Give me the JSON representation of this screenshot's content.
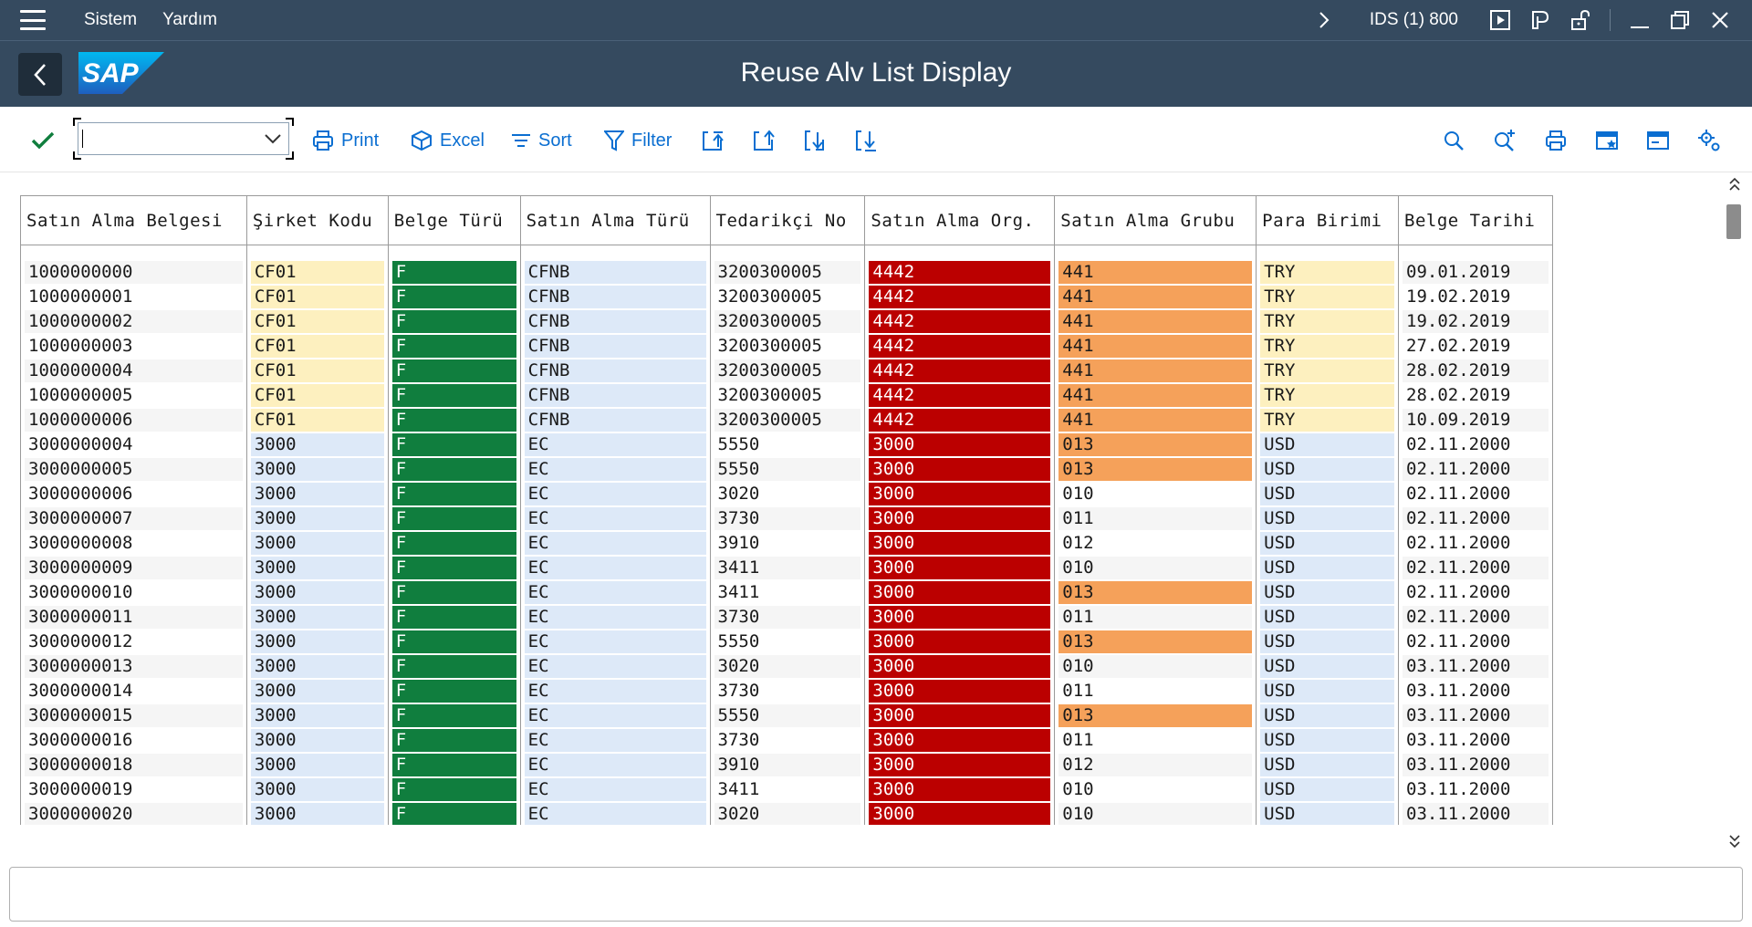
{
  "menu": {
    "items": [
      "Sistem",
      "Yardım"
    ],
    "system_info": "IDS (1) 800"
  },
  "titlebar": {
    "title": "Reuse Alv List Display",
    "logo_text": "SAP"
  },
  "toolbar": {
    "command_field_value": "",
    "buttons": {
      "print": "Print",
      "excel": "Excel",
      "sort": "Sort",
      "filter": "Filter"
    }
  },
  "colors": {
    "shell": "#354a5f",
    "link_blue": "#0a6ed1",
    "yellow": "#fdf0bf",
    "lightblue": "#dde9f8",
    "green": "#107e3e",
    "red": "#bb0000",
    "orange": "#f5a15a"
  },
  "table": {
    "headers": [
      "Satın Alma Belgesi",
      "Şirket Kodu",
      "Belge Türü",
      "Satın Alma Türü",
      "Tedarikçi No",
      "Satın Alma Org.",
      "Satın Alma Grubu",
      "Para Birimi",
      "Belge Tarihi"
    ],
    "rows": [
      [
        "1000000000",
        "CF01",
        "F",
        "CFNB",
        "3200300005",
        "4442",
        "441",
        "TRY",
        "09.01.2019"
      ],
      [
        "1000000001",
        "CF01",
        "F",
        "CFNB",
        "3200300005",
        "4442",
        "441",
        "TRY",
        "19.02.2019"
      ],
      [
        "1000000002",
        "CF01",
        "F",
        "CFNB",
        "3200300005",
        "4442",
        "441",
        "TRY",
        "19.02.2019"
      ],
      [
        "1000000003",
        "CF01",
        "F",
        "CFNB",
        "3200300005",
        "4442",
        "441",
        "TRY",
        "27.02.2019"
      ],
      [
        "1000000004",
        "CF01",
        "F",
        "CFNB",
        "3200300005",
        "4442",
        "441",
        "TRY",
        "28.02.2019"
      ],
      [
        "1000000005",
        "CF01",
        "F",
        "CFNB",
        "3200300005",
        "4442",
        "441",
        "TRY",
        "28.02.2019"
      ],
      [
        "1000000006",
        "CF01",
        "F",
        "CFNB",
        "3200300005",
        "4442",
        "441",
        "TRY",
        "10.09.2019"
      ],
      [
        "3000000004",
        "3000",
        "F",
        "EC",
        "5550",
        "3000",
        "013",
        "USD",
        "02.11.2000"
      ],
      [
        "3000000005",
        "3000",
        "F",
        "EC",
        "5550",
        "3000",
        "013",
        "USD",
        "02.11.2000"
      ],
      [
        "3000000006",
        "3000",
        "F",
        "EC",
        "3020",
        "3000",
        "010",
        "USD",
        "02.11.2000"
      ],
      [
        "3000000007",
        "3000",
        "F",
        "EC",
        "3730",
        "3000",
        "011",
        "USD",
        "02.11.2000"
      ],
      [
        "3000000008",
        "3000",
        "F",
        "EC",
        "3910",
        "3000",
        "012",
        "USD",
        "02.11.2000"
      ],
      [
        "3000000009",
        "3000",
        "F",
        "EC",
        "3411",
        "3000",
        "010",
        "USD",
        "02.11.2000"
      ],
      [
        "3000000010",
        "3000",
        "F",
        "EC",
        "3411",
        "3000",
        "013",
        "USD",
        "02.11.2000"
      ],
      [
        "3000000011",
        "3000",
        "F",
        "EC",
        "3730",
        "3000",
        "011",
        "USD",
        "02.11.2000"
      ],
      [
        "3000000012",
        "3000",
        "F",
        "EC",
        "5550",
        "3000",
        "013",
        "USD",
        "02.11.2000"
      ],
      [
        "3000000013",
        "3000",
        "F",
        "EC",
        "3020",
        "3000",
        "010",
        "USD",
        "03.11.2000"
      ],
      [
        "3000000014",
        "3000",
        "F",
        "EC",
        "3730",
        "3000",
        "011",
        "USD",
        "03.11.2000"
      ],
      [
        "3000000015",
        "3000",
        "F",
        "EC",
        "5550",
        "3000",
        "013",
        "USD",
        "03.11.2000"
      ],
      [
        "3000000016",
        "3000",
        "F",
        "EC",
        "3730",
        "3000",
        "011",
        "USD",
        "03.11.2000"
      ],
      [
        "3000000018",
        "3000",
        "F",
        "EC",
        "3910",
        "3000",
        "012",
        "USD",
        "03.11.2000"
      ],
      [
        "3000000019",
        "3000",
        "F",
        "EC",
        "3411",
        "3000",
        "010",
        "USD",
        "03.11.2000"
      ],
      [
        "3000000020",
        "3000",
        "F",
        "EC",
        "3020",
        "3000",
        "010",
        "USD",
        "03.11.2000"
      ]
    ]
  },
  "statusbar": {
    "message": ""
  }
}
